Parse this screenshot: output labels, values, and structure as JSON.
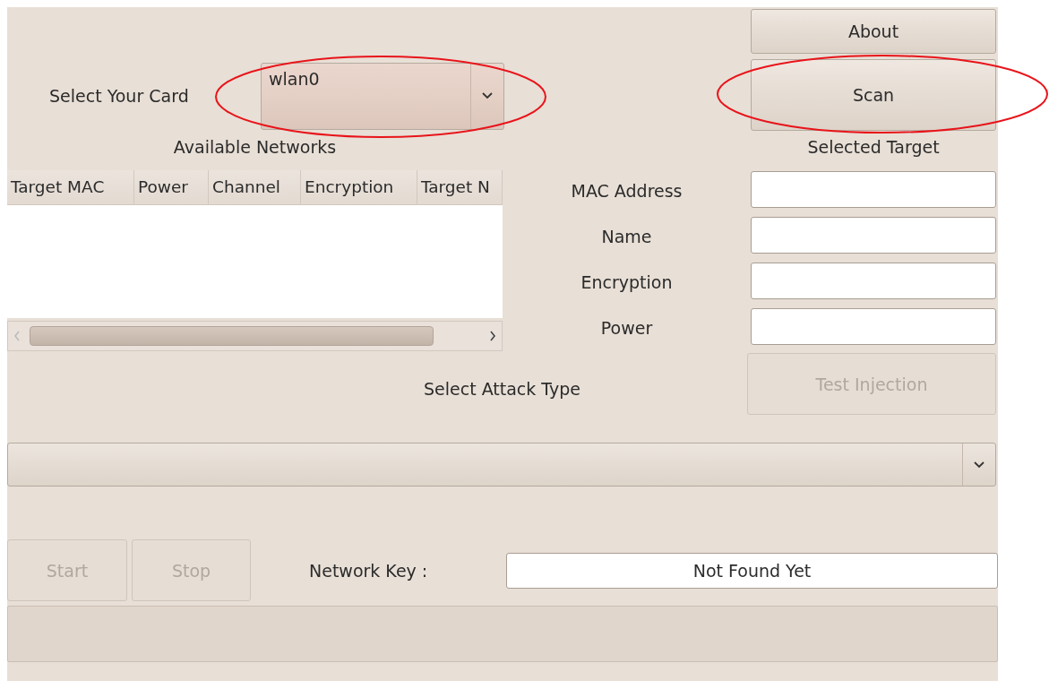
{
  "card_select": {
    "label": "Select Your Card",
    "value": "wlan0",
    "highlighted": true
  },
  "about_button": {
    "label": "About"
  },
  "scan_button": {
    "label": "Scan",
    "highlighted": true
  },
  "networks": {
    "title": "Available Networks",
    "columns": [
      "Target MAC",
      "Power",
      "Channel",
      "Encryption",
      "Target N"
    ]
  },
  "target": {
    "title": "Selected Target",
    "fields": [
      {
        "label": "MAC Address"
      },
      {
        "label": "Name"
      },
      {
        "label": "Encryption"
      },
      {
        "label": "Power"
      }
    ]
  },
  "attack": {
    "label": "Select Attack Type",
    "test_button": {
      "label": "Test Injection",
      "disabled": true
    }
  },
  "controls": {
    "buttons": [
      {
        "label": "Start",
        "disabled": true
      },
      {
        "label": "Stop",
        "disabled": true
      }
    ],
    "key_label": "Network Key :",
    "key_value": "Not Found Yet"
  }
}
